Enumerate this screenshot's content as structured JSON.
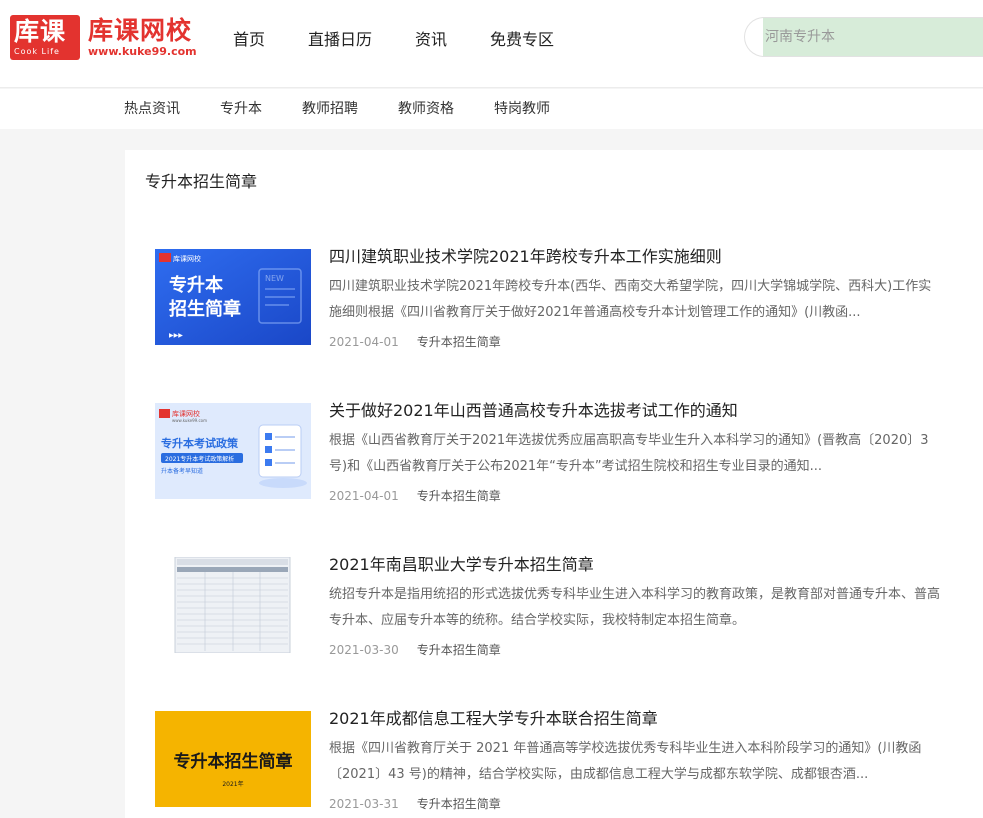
{
  "logo": {
    "cn": "库课",
    "en": "Cook Life",
    "name": "库课网校",
    "url": "www.kuke99.com"
  },
  "nav": [
    "首页",
    "直播日历",
    "资讯",
    "免费专区"
  ],
  "search": {
    "placeholder": "河南专升本"
  },
  "subnav": [
    "热点资讯",
    "专升本",
    "教师招聘",
    "教师资格",
    "特岗教师"
  ],
  "section_title": "专升本招生简章",
  "articles": [
    {
      "title": "四川建筑职业技术学院2021年跨校专升本工作实施细则",
      "summary": "四川建筑职业技术学院2021年跨校专升本(西华、西南交大希望学院，四川大学锦城学院、西科大)工作实施细则根据《四川省教育厅关于做好2021年普通高校专升本计划管理工作的通知》(川教函...",
      "date": "2021-04-01",
      "tag": "专升本招生简章",
      "thumb": {
        "brand": "库课网校",
        "line1": "专升本",
        "line2": "招生简章",
        "doc_label": "NEW",
        "arrows": "▶▶▶"
      }
    },
    {
      "title": "关于做好2021年山西普通高校专升本选拔考试工作的通知",
      "summary": "根据《山西省教育厅关于2021年选拔优秀应届高职高专毕业生升入本科学习的通知》(晋教高〔2020〕3号)和《山西省教育厅关于公布2021年“专升本”考试招生院校和招生专业目录的通知...",
      "date": "2021-04-01",
      "tag": "专升本招生简章",
      "thumb": {
        "brand": "库课网校",
        "url": "www.kuke99.com",
        "line1": "专升本考试政策",
        "band": "2021专升本考试政策解析",
        "line3": "升本备考早知道"
      }
    },
    {
      "title": "2021年南昌职业大学专升本招生简章",
      "summary": "统招专升本是指用统招的形式选拔优秀专科毕业生进入本科学习的教育政策，是教育部对普通专升本、普高专升本、应届专升本等的统称。结合学校实际，我校特制定本招生简章。",
      "date": "2021-03-30",
      "tag": "专升本招生简章"
    },
    {
      "title": "2021年成都信息工程大学专升本联合招生简章",
      "summary": "根据《四川省教育厅关于 2021 年普通高等学校选拔优秀专科毕业生进入本科阶段学习的通知》(川教函〔2021〕43 号)的精神，结合学校实际，由成都信息工程大学与成都东软学院、成都银杏酒...",
      "date": "2021-03-31",
      "tag": "专升本招生简章",
      "thumb": {
        "line1": "专升本招生简章",
        "year": "2021年"
      }
    }
  ],
  "colors": {
    "brand_red": "#e3332f",
    "thumb1_blue": "#1f5bd8",
    "thumb4_yellow": "#f5b400",
    "search_bg": "#d7ecd9"
  }
}
